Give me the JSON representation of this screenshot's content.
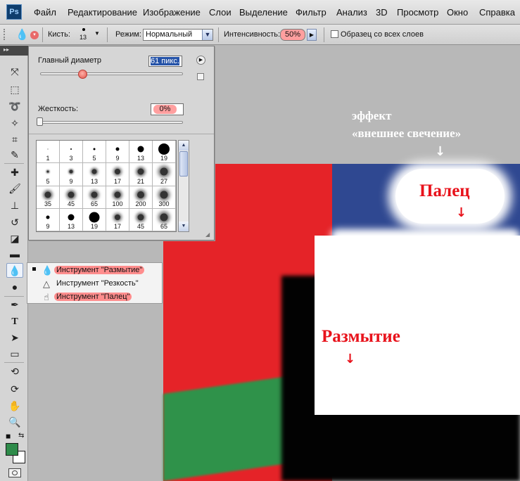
{
  "menubar": {
    "logo": "Ps",
    "items": [
      "Файл",
      "Редактирование",
      "Изображение",
      "Слои",
      "Выделение",
      "Фильтр",
      "Анализ",
      "3D",
      "Просмотр",
      "Окно",
      "Справка"
    ]
  },
  "options": {
    "brush_label": "Кисть:",
    "brush_size": "13",
    "mode_label": "Режим:",
    "mode_value": "Нормальный",
    "intensity_label": "Интенсивность:",
    "intensity_value": "50%",
    "sample_all_label": "Образец со всех слоев"
  },
  "brush_panel": {
    "diameter_label": "Главный диаметр",
    "diameter_value": "61 пикс.",
    "hardness_label": "Жесткость:",
    "hardness_value": "0%",
    "presets": [
      "1",
      "3",
      "5",
      "9",
      "13",
      "19",
      "5",
      "9",
      "13",
      "17",
      "21",
      "27",
      "35",
      "45",
      "65",
      "100",
      "200",
      "300",
      "9",
      "13",
      "19",
      "17",
      "45",
      "65"
    ]
  },
  "flyout": {
    "items": [
      {
        "label": "Инструмент \"Размытие\"",
        "icon": "drop-icon",
        "active": true
      },
      {
        "label": "Инструмент \"Резкость\"",
        "icon": "cone-icon",
        "active": false
      },
      {
        "label": "Инструмент \"Палец\"",
        "icon": "finger-icon",
        "active": false
      }
    ]
  },
  "annotations": {
    "glow_line1": "эффект",
    "glow_line2": "«внешнее свечение»",
    "finger": "Палец",
    "blur": "Размытие"
  },
  "colors": {
    "foreground": "#2e8b4a",
    "background": "#ffffff",
    "red_region": "#e52328",
    "blue_region": "#2f4891",
    "highlight": "#ff9f9f"
  }
}
